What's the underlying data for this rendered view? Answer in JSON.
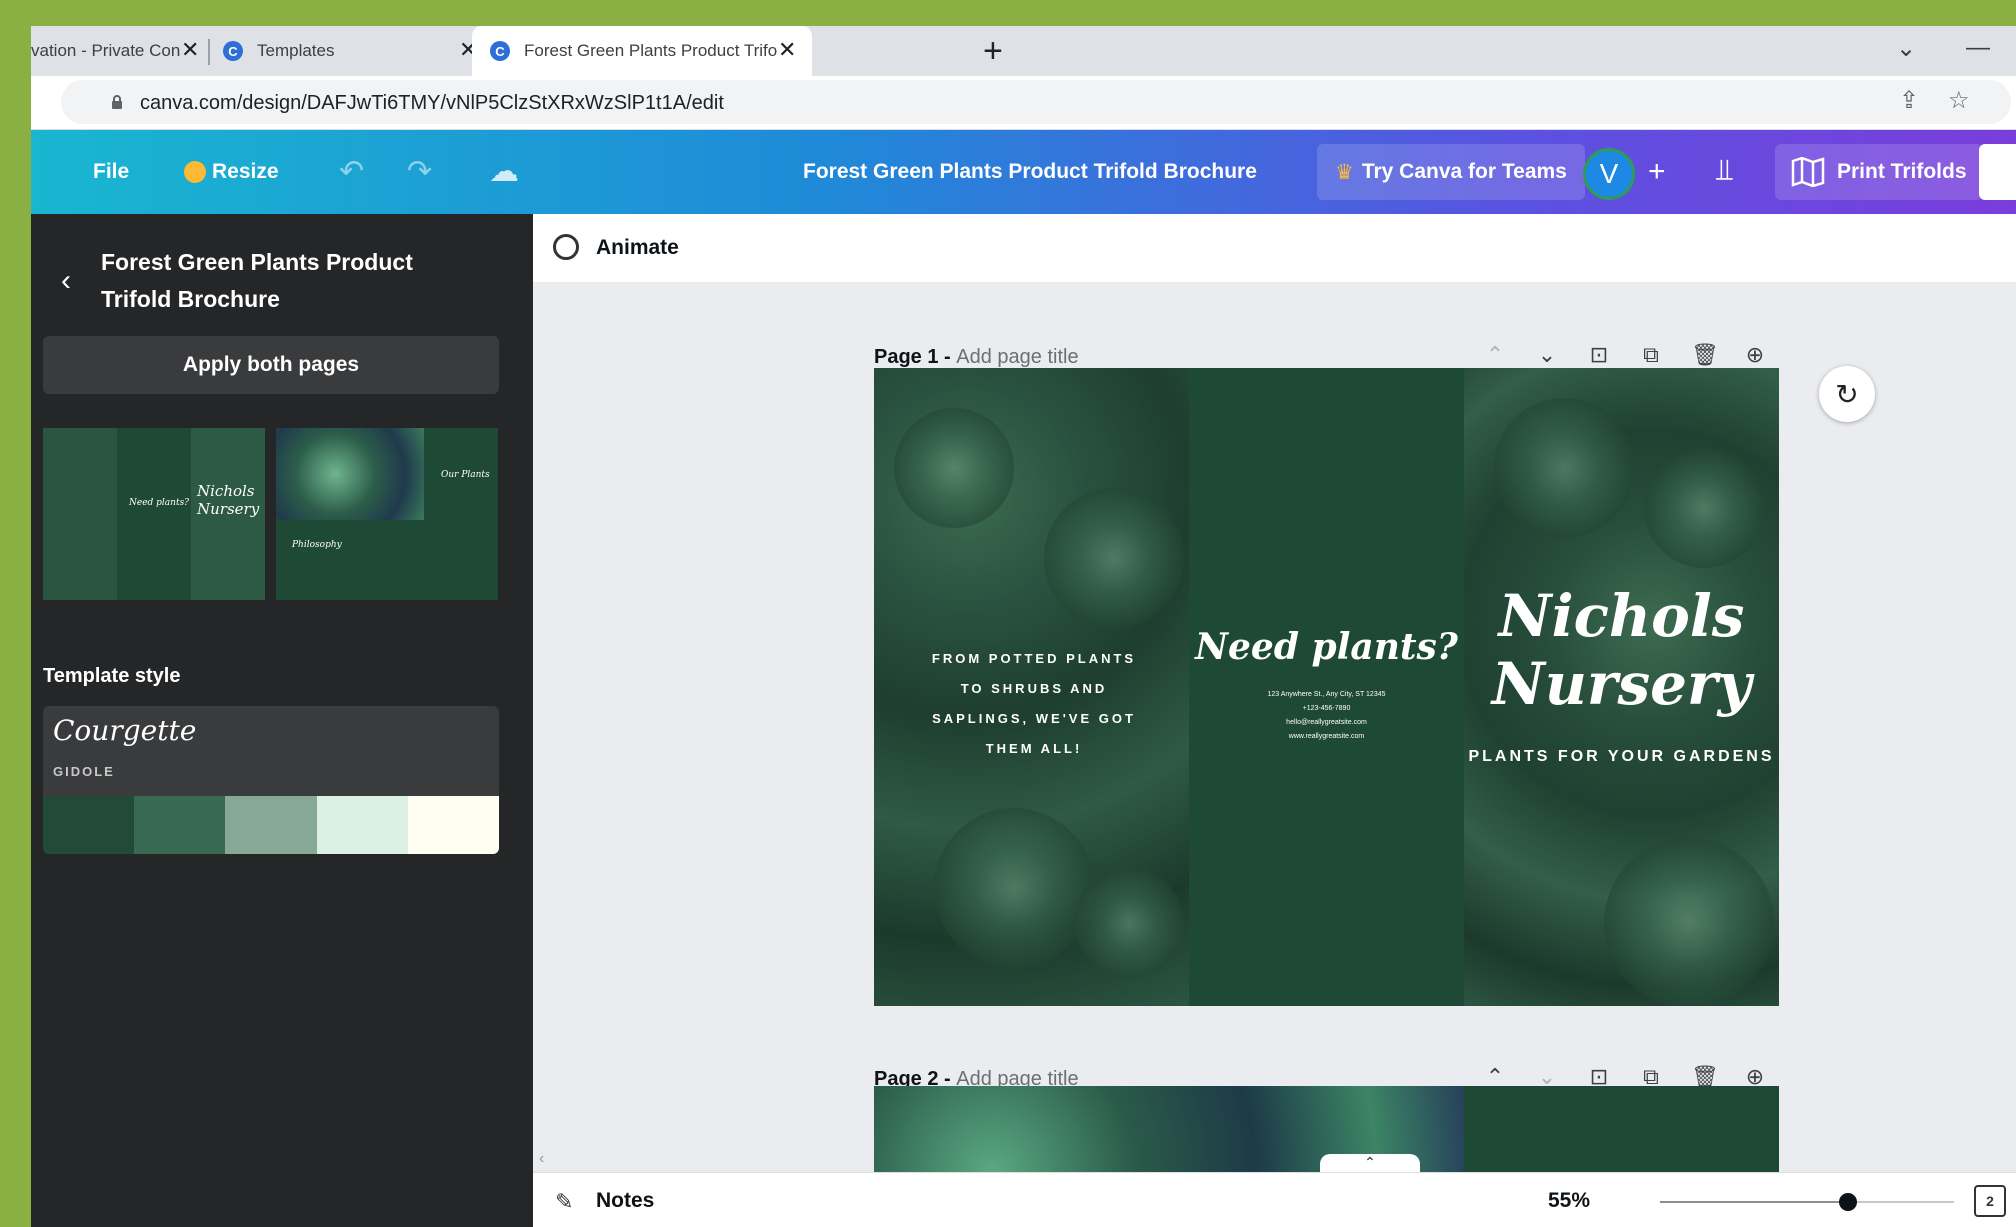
{
  "browser": {
    "tabs": [
      {
        "title": "vation - Private Consulta",
        "close": "✕"
      },
      {
        "title": "Templates",
        "close": "✕"
      },
      {
        "title": "Forest Green Plants Product Trifo",
        "close": "✕"
      }
    ],
    "favicon_letter": "C",
    "new_tab": "+",
    "url": "canva.com/design/DAFJwTi6TMY/vNlP5ClzStXRxWzSlP1t1A/edit"
  },
  "topbar": {
    "file": "File",
    "resize": "Resize",
    "doc_title": "Forest Green Plants Product Trifold Brochure",
    "try_teams": "Try Canva for Teams",
    "avatar_letter": "V",
    "add": "+",
    "print": "Print Trifolds"
  },
  "left_panel": {
    "title": "Forest Green Plants Product Trifold Brochure",
    "apply_both": "Apply both pages",
    "thumb1_text": "Nichols Nursery",
    "thumb1_small": "Need plants?",
    "thumb2_text": "Our Plants",
    "thumb2_small": "Philosophy",
    "template_style_heading": "Template style",
    "style_font": "Courgette",
    "style_subfont": "GIDOLE",
    "swatches": [
      "#234a39",
      "#386a52",
      "#87a895",
      "#ddf0e4",
      "#fefff0"
    ]
  },
  "editor": {
    "animate": "Animate",
    "page1": {
      "label": "Page 1 - ",
      "sub": "Add page title"
    },
    "page2": {
      "label": "Page 2 - ",
      "sub": "Add page title"
    },
    "brochure": {
      "left_text": "FROM POTTED PLANTS TO SHRUBS AND SAPLINGS, WE'VE GOT THEM ALL!",
      "middle_title": "Need plants?",
      "middle_contact": [
        "123 Anywhere St., Any City, ST 12345",
        "+123-456-7890",
        "hello@reallygreatsite.com",
        "www.reallygreatsite.com"
      ],
      "right_title": "Nichols Nursery",
      "right_sub": "PLANTS FOR YOUR GARDENS"
    },
    "notes": "Notes",
    "zoom": "55%",
    "zoom_fraction": 0.55,
    "page_count": "2"
  },
  "colors": {
    "page_bg": "#8ab043",
    "brochure_green": "#1e4a35",
    "panel_bg": "#252627"
  }
}
